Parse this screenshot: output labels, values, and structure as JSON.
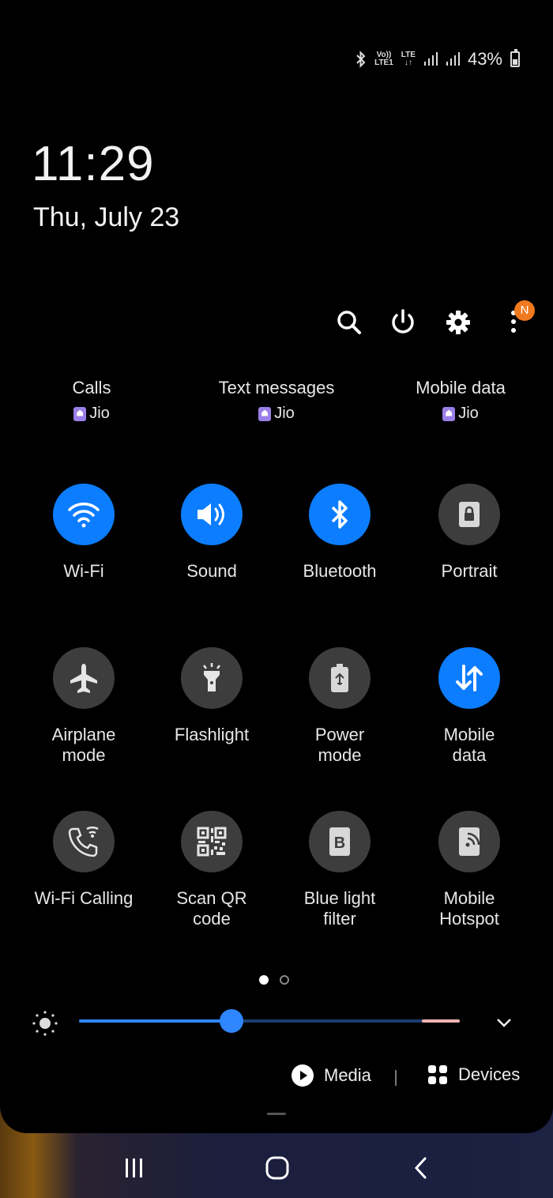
{
  "status": {
    "bluetooth_icon": "bluetooth-icon",
    "volte_top": "Vo))",
    "volte_bottom": "LTE1",
    "lte_top": "LTE",
    "lte_bottom": "↓↑",
    "battery_percent": "43%"
  },
  "clock": {
    "time": "11:29",
    "date": "Thu, July 23"
  },
  "top_actions": {
    "notification_badge": "N",
    "icons": [
      "search-icon",
      "power-icon",
      "settings-icon",
      "more-icon"
    ]
  },
  "sim_prefs": [
    {
      "label": "Calls",
      "carrier": "Jio"
    },
    {
      "label": "Text messages",
      "carrier": "Jio"
    },
    {
      "label": "Mobile data",
      "carrier": "Jio"
    }
  ],
  "tiles": [
    {
      "label": "Wi-Fi",
      "icon": "wifi-icon",
      "on": true
    },
    {
      "label": "Sound",
      "icon": "sound-icon",
      "on": true
    },
    {
      "label": "Bluetooth",
      "icon": "bluetooth-icon",
      "on": true
    },
    {
      "label": "Portrait",
      "icon": "portrait-lock-icon",
      "on": false
    },
    {
      "label": "Airplane\nmode",
      "icon": "airplane-icon",
      "on": false
    },
    {
      "label": "Flashlight",
      "icon": "flashlight-icon",
      "on": false
    },
    {
      "label": "Power\nmode",
      "icon": "power-mode-icon",
      "on": false
    },
    {
      "label": "Mobile\ndata",
      "icon": "mobile-data-icon",
      "on": true
    },
    {
      "label": "Wi-Fi Calling",
      "icon": "wifi-calling-icon",
      "on": false
    },
    {
      "label": "Scan QR\ncode",
      "icon": "qr-code-icon",
      "on": false
    },
    {
      "label": "Blue light\nfilter",
      "icon": "blue-light-icon",
      "on": false
    },
    {
      "label": "Mobile\nHotspot",
      "icon": "hotspot-icon",
      "on": false
    }
  ],
  "pager": {
    "current": 1,
    "total": 2
  },
  "brightness": {
    "level_fraction": 0.4
  },
  "media": {
    "media_label": "Media",
    "devices_label": "Devices"
  },
  "colors": {
    "accent": "#0c7dff",
    "tile_off": "#3d3d3d",
    "badge": "#f07a1f"
  }
}
